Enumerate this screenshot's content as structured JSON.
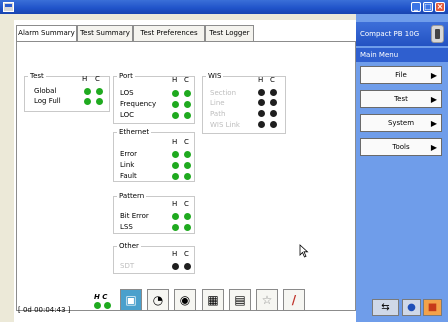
{
  "window": {
    "title": "",
    "icon": "window-icon",
    "controls": [
      "minimize-icon",
      "restore-icon",
      "close-icon"
    ]
  },
  "tabs": [
    {
      "label": "Alarm Summary",
      "active": true
    },
    {
      "label": "Test Summary",
      "active": false
    },
    {
      "label": "Test Preferences",
      "active": false
    },
    {
      "label": "Test Logger",
      "active": false
    }
  ],
  "groups": {
    "test": {
      "title": "Test",
      "h": "H",
      "c": "C",
      "rows": [
        {
          "label": "Global",
          "status": [
            "green",
            "green"
          ],
          "disabled": false
        },
        {
          "label": "Log Full",
          "status": [
            "green",
            "green"
          ],
          "disabled": false
        }
      ]
    },
    "port": {
      "title": "Port",
      "h": "H",
      "c": "C",
      "rows": [
        {
          "label": "LOS",
          "status": [
            "green",
            "green"
          ],
          "disabled": false
        },
        {
          "label": "Frequency",
          "status": [
            "green",
            "green"
          ],
          "disabled": false
        },
        {
          "label": "LOC",
          "status": [
            "green",
            "green"
          ],
          "disabled": false
        }
      ]
    },
    "wis": {
      "title": "WIS",
      "h": "H",
      "c": "C",
      "rows": [
        {
          "label": "Section",
          "status": [
            "black",
            "black"
          ],
          "disabled": true
        },
        {
          "label": "Line",
          "status": [
            "black",
            "black"
          ],
          "disabled": true
        },
        {
          "label": "Path",
          "status": [
            "black",
            "black"
          ],
          "disabled": true
        },
        {
          "label": "WIS Link",
          "status": [
            "black",
            "black"
          ],
          "disabled": true
        }
      ]
    },
    "ethernet": {
      "title": "Ethernet",
      "h": "H",
      "c": "C",
      "rows": [
        {
          "label": "Error",
          "status": [
            "green",
            "green"
          ],
          "disabled": false
        },
        {
          "label": "Link",
          "status": [
            "green",
            "green"
          ],
          "disabled": false
        },
        {
          "label": "Fault",
          "status": [
            "green",
            "green"
          ],
          "disabled": false
        }
      ]
    },
    "pattern": {
      "title": "Pattern",
      "h": "H",
      "c": "C",
      "rows": [
        {
          "label": "Bit Error",
          "status": [
            "green",
            "green"
          ],
          "disabled": false
        },
        {
          "label": "LSS",
          "status": [
            "green",
            "green"
          ],
          "disabled": false
        }
      ]
    },
    "other": {
      "title": "Other",
      "h": "H",
      "c": "C",
      "rows": [
        {
          "label": "SDT",
          "status": [
            "black",
            "black"
          ],
          "disabled": true
        }
      ]
    }
  },
  "status_bar": {
    "elapsed": "[ 0d 00:04:43 ]",
    "hc_label": "H C"
  },
  "toolbar": [
    {
      "name": "run-test-icon",
      "glyph": "▣"
    },
    {
      "name": "clock-icon",
      "glyph": "◔"
    },
    {
      "name": "camera-icon",
      "glyph": "◉"
    },
    {
      "name": "grid-icon",
      "glyph": "▦"
    },
    {
      "name": "panels-icon",
      "glyph": "▤"
    },
    {
      "name": "star-icon",
      "glyph": "☆"
    },
    {
      "name": "inject-icon",
      "glyph": "/"
    }
  ],
  "sidebar": {
    "product": "Compact PB 10G",
    "menu_title": "Main Menu",
    "items": [
      {
        "label": "File"
      },
      {
        "label": "Test"
      },
      {
        "label": "System"
      },
      {
        "label": "Tools"
      }
    ],
    "bottom_buttons": [
      {
        "name": "network-icon",
        "glyph": "⇆"
      },
      {
        "name": "disk-icon",
        "glyph": "●"
      },
      {
        "name": "stop-icon",
        "glyph": "■"
      }
    ]
  },
  "colors": {
    "status_green": "#1faa1f",
    "status_black": "#1f1f1f",
    "titlebar_blue": "#1f52c8",
    "sidebar_blue": "#6f9dea"
  }
}
